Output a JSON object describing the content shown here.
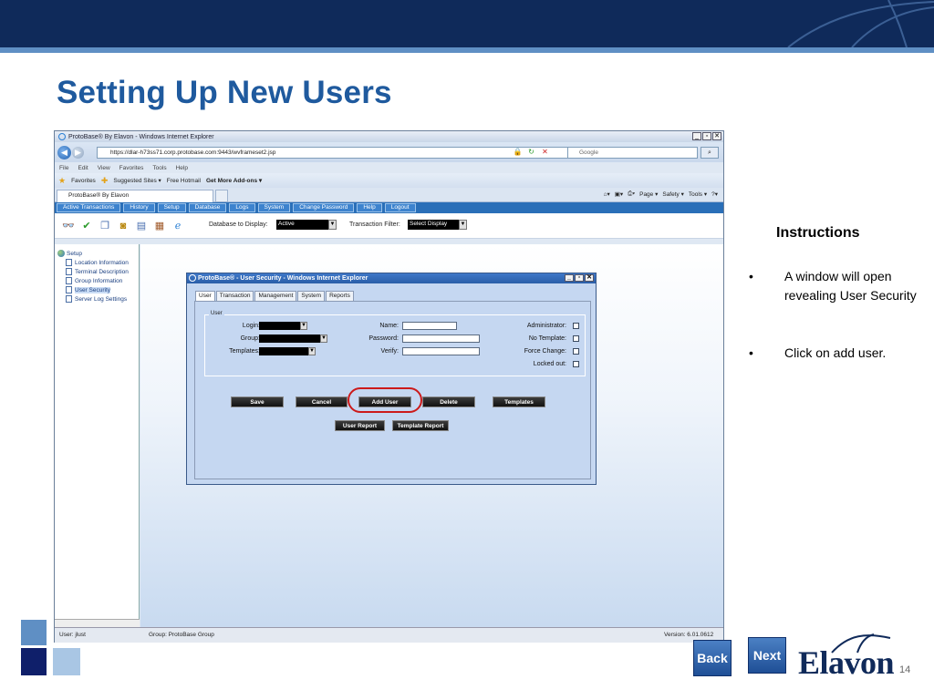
{
  "slide": {
    "title": "Setting Up New Users",
    "page_number": "14",
    "nav_back": "Back",
    "nav_next": "Next",
    "logo": "Elavon"
  },
  "browser": {
    "window_title": "ProtoBase® By Elavon - Windows Internet Explorer",
    "url": "https://dlar-h73ss71.corp.protobase.com:9443/wvframeset2.jsp",
    "search_placeholder": "Google",
    "menu": [
      "File",
      "Edit",
      "View",
      "Favorites",
      "Tools",
      "Help"
    ],
    "favorites_label": "Favorites",
    "fav_links": [
      "Suggested Sites ▾",
      "Free Hotmail",
      "Get More Add-ons ▾"
    ],
    "tab_label": "ProtoBase® By Elavon",
    "command_items": [
      "Page ▾",
      "Safety ▾",
      "Tools ▾"
    ]
  },
  "app": {
    "nav": [
      "Active Transactions",
      "History",
      "Setup",
      "Database",
      "Logs",
      "System",
      "Change Password",
      "Help",
      "Logout"
    ],
    "db_label": "Database to Display:",
    "db_value": "Active",
    "tf_label": "Transaction Filter:",
    "tf_value": "Select Display",
    "tree": {
      "root": "Setup",
      "items": [
        "Location Information",
        "Terminal Description",
        "Group Information",
        "User Security",
        "Server Log Settings"
      ],
      "selected_index": 3
    },
    "status": {
      "user": "User: jlust",
      "group": "Group: ProtoBase Group",
      "version": "Version: 6.01.0612"
    }
  },
  "popup": {
    "title": "ProtoBase® - User Security - Windows Internet Explorer",
    "tabs": [
      "User",
      "Transaction",
      "Management",
      "System",
      "Reports"
    ],
    "active_tab": 0,
    "fieldset_label": "User",
    "labels": {
      "login": "Login:",
      "group": "Group:",
      "templates": "Templates:",
      "name": "Name:",
      "password": "Password:",
      "verify": "Verify:",
      "administrator": "Administrator:",
      "no_template": "No Template:",
      "force_change": "Force Change:",
      "locked_out": "Locked out:"
    },
    "buttons": [
      "Save",
      "Cancel",
      "Add User",
      "Delete",
      "Templates"
    ],
    "buttons_row2": [
      "User Report",
      "Template Report"
    ]
  },
  "instructions": {
    "title": "Instructions",
    "bullets": [
      "A window will open revealing User Security",
      "Click on add user."
    ],
    "bullet_char": "•"
  },
  "colors": {
    "header_band": "#0f2a5a",
    "title": "#1f5a9e",
    "highlight": "#cc1a1a"
  }
}
